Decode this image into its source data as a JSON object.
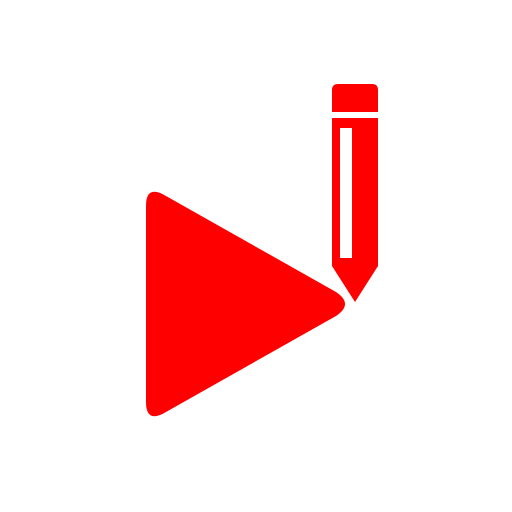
{
  "logo": {
    "name": "play-edit-logo",
    "icons": [
      "play-triangle-icon",
      "pencil-icon"
    ]
  },
  "colors": {
    "background": "#ffffff",
    "brand": "#ff0000"
  }
}
